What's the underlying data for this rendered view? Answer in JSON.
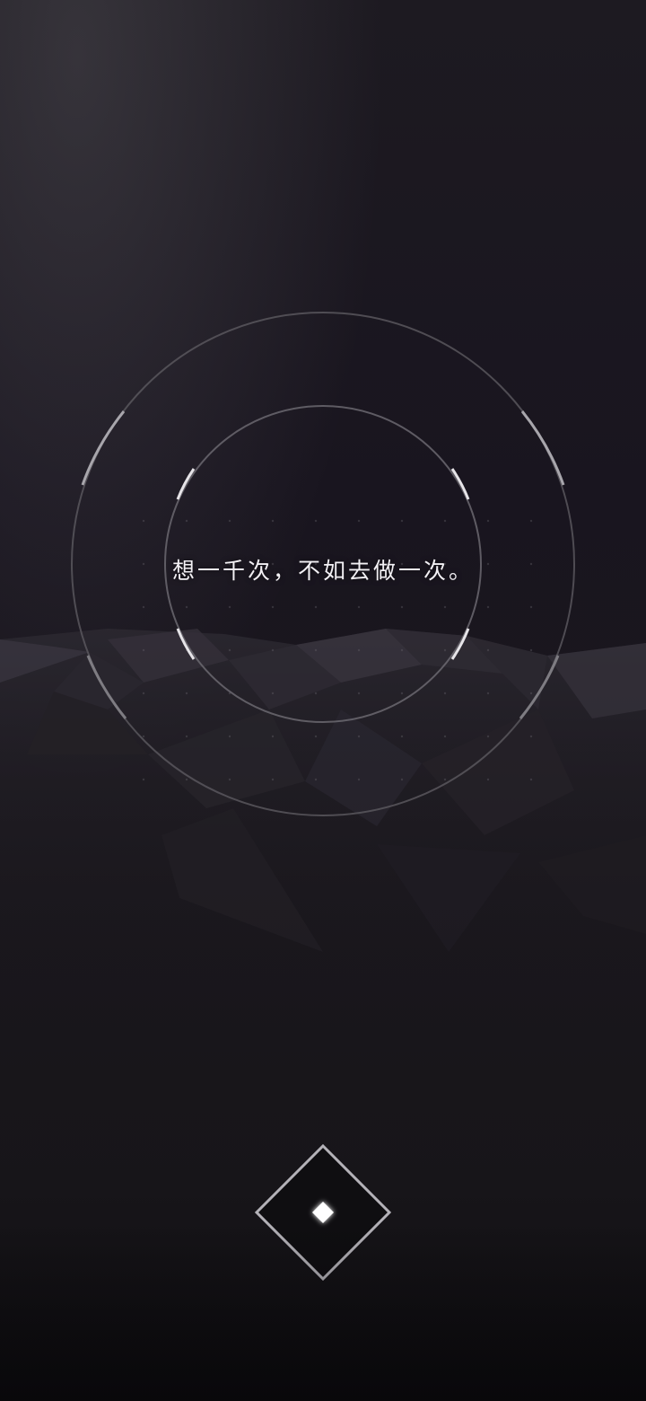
{
  "splash": {
    "quote": "想一千次，不如去做一次。"
  },
  "icons": {
    "start": "diamond-icon"
  },
  "colors": {
    "background": "#19161d",
    "ring": "#8a888e",
    "text": "#f2f0f4",
    "accent": "#ffffff"
  }
}
